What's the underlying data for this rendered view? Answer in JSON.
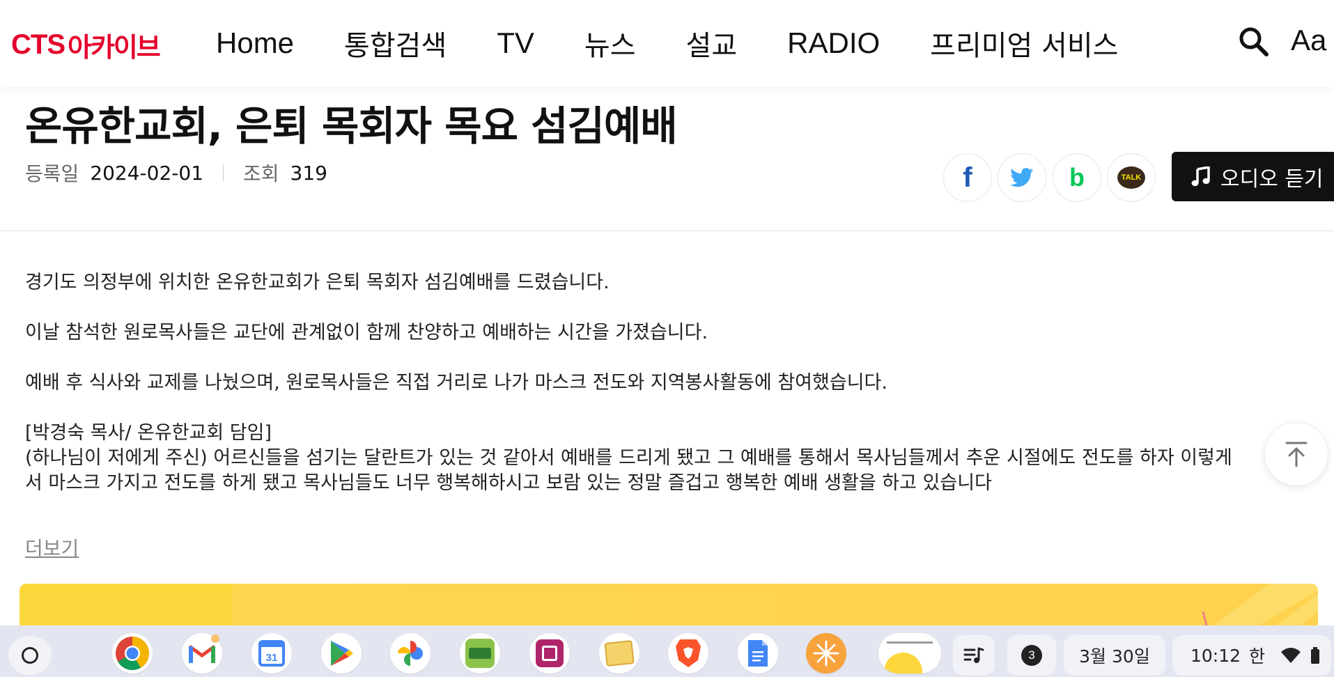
{
  "header": {
    "logo_latin": "CTS",
    "logo_korean": "아카이브",
    "nav": [
      "Home",
      "통합검색",
      "TV",
      "뉴스",
      "설교",
      "RADIO",
      "프리미엄 서비스"
    ],
    "font_size_label": "Aa"
  },
  "article": {
    "title": "온유한교회, 은퇴 목회자 목요 섬김예배",
    "registered_label": "등록일",
    "registered_value": "2024-02-01",
    "views_label": "조회",
    "views_value": "319",
    "audio_label": "오디오 듣기",
    "paragraphs": [
      "경기도 의정부에 위치한 온유한교회가 은퇴 목회자 섬김예배를 드렸습니다.",
      "이날 참석한 원로목사들은 교단에 관계없이 함께 찬양하고 예배하는 시간을 가졌습니다.",
      "예배 후 식사와 교제를 나눴으며, 원로목사들은 직접 거리로 나가 마스크 전도와 지역봉사활동에 참여했습니다.",
      "[박경숙 목사/ 온유한교회 담임]",
      "(하나님이 저에게 주신) 어르신들을 섬기는 달란트가 있는 것 같아서 예배를 드리게 됐고 그 예배를 통해서 목사님들께서 추운 시절에도 전도를 하자 이렇게",
      "서 마스크 가지고 전도를 하게 됐고 목사님들도 너무 행복해하시고 보람 있는 정말 즐겁고 행복한 예배 생활을 하고 있습니다"
    ],
    "more_label": "더보기"
  },
  "share": {
    "facebook": "f",
    "band": "b",
    "kakao": "TALK"
  },
  "shelf": {
    "calendar_day": "31",
    "notification_count": "3",
    "date": "3월 30일",
    "time": "10:12",
    "ime": "한"
  },
  "colors": {
    "brand_red": "#e4002b",
    "facebook": "#1f5ab5",
    "twitter": "#3fa9f5",
    "band": "#06c755",
    "kakao": "#3b2a1a",
    "banner": "#fed24f"
  }
}
